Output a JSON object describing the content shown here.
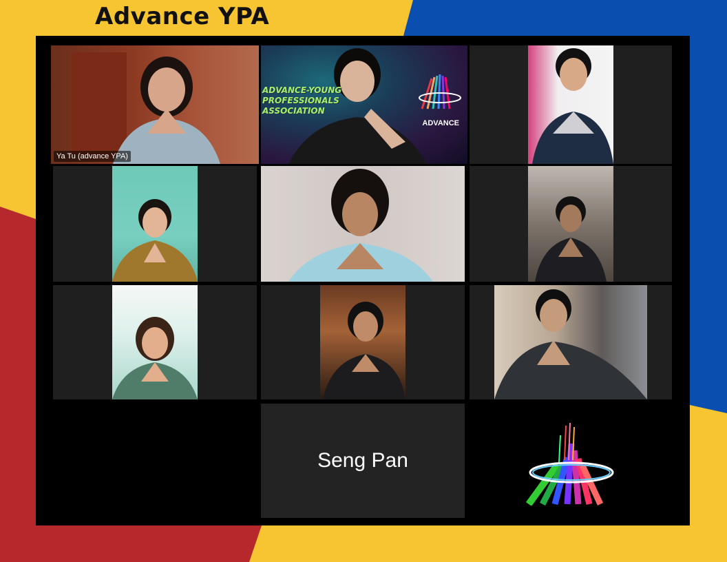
{
  "page": {
    "title": "Advance YPA"
  },
  "meeting": {
    "participants": [
      {
        "id": "p1",
        "name": "Ya Tu (advance YPA)",
        "speaking": true
      },
      {
        "id": "p2",
        "banner_text": "ADVANCE-YOUNG PROFESSIONALS ASSOCIATION",
        "banner_brand": "ADVANCE"
      },
      {
        "id": "p3"
      },
      {
        "id": "p4"
      },
      {
        "id": "p5"
      },
      {
        "id": "p6"
      },
      {
        "id": "p7"
      },
      {
        "id": "p8"
      },
      {
        "id": "p9"
      },
      {
        "id": "p10",
        "name": "Seng Pan",
        "video": false
      },
      {
        "id": "p11",
        "logo": "advance-logo-icon"
      }
    ]
  },
  "colors": {
    "yellow": "#f6c531",
    "blue": "#0a4fb0",
    "red": "#b7282d",
    "speaker_outline": "#cde36a"
  }
}
